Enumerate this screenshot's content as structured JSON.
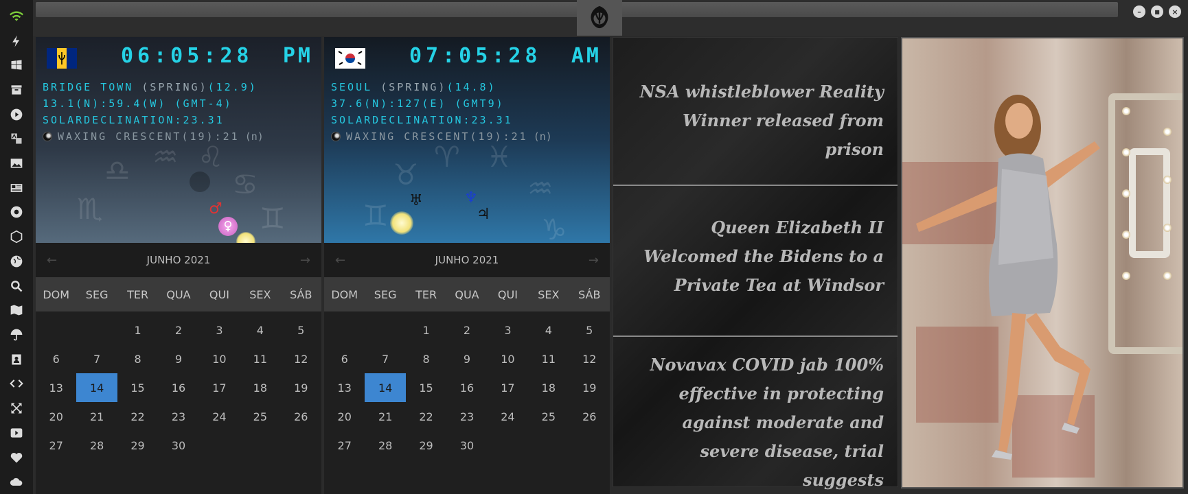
{
  "sidebar": {
    "icons": [
      "wifi-icon",
      "bolt-icon",
      "windows-icon",
      "archive-icon",
      "play-icon",
      "translate-icon",
      "image-icon",
      "news-icon",
      "rebel-icon",
      "hex-icon",
      "globe-icon",
      "search-icon",
      "map-icon",
      "umbrella-icon",
      "contacts-icon",
      "code-icon",
      "expand-icon",
      "youtube-icon",
      "heart-icon",
      "cloud-icon"
    ]
  },
  "window": {
    "minimize": "–",
    "maximize": "■",
    "close": "×"
  },
  "clocks": [
    {
      "time": "06:05:28",
      "ampm": "PM",
      "city_prefix": "BRIDGE TOWN ",
      "season": "(SPRING)",
      "city_suffix": "(12.9)",
      "coords": "13.1(N):59.4(W) (GMT-4)",
      "declination": "SOLARDECLINATION:23.31",
      "moon": "WAXING CRESCENT(19):21",
      "moon_suffix": "(n)",
      "flag": "barbados"
    },
    {
      "time": "07:05:28",
      "ampm": "AM",
      "city_prefix": "SEOUL ",
      "season": "(SPRING)",
      "city_suffix": "(14.8)",
      "coords": "37.6(N):127(E) (GMT9)",
      "declination": "SOLARDECLINATION:23.31",
      "moon": "WAXING CRESCENT(19):21",
      "moon_suffix": "(n)",
      "flag": "south-korea"
    }
  ],
  "calendars": [
    {
      "month": "JUNHO 2021",
      "prev": "←",
      "next": "→",
      "dow": [
        "DOM",
        "SEG",
        "TER",
        "QUA",
        "QUI",
        "SEX",
        "SÁB"
      ],
      "selected": 14
    },
    {
      "month": "JUNHO 2021",
      "prev": "←",
      "next": "→",
      "dow": [
        "DOM",
        "SEG",
        "TER",
        "QUA",
        "QUI",
        "SEX",
        "SÁB"
      ],
      "selected": 14
    }
  ],
  "news": [
    "NSA whistleblower Reality Winner released from prison",
    "Queen Elizabeth II Welcomed the Bidens to a Private Tea at Windsor",
    "Novavax COVID jab 100% effective in protecting against moderate and severe disease, trial suggests"
  ],
  "colors": {
    "accent": "#25d2e6",
    "selected_day": "#3d86d1"
  }
}
